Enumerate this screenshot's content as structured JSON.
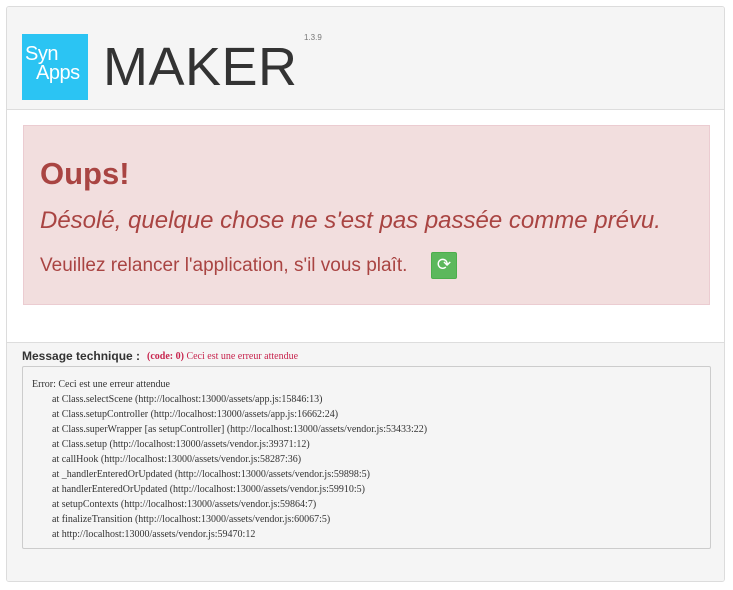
{
  "header": {
    "logo_line1": "Syn",
    "logo_line2": "Apps",
    "title": "MAKER",
    "version": "1.3.9"
  },
  "alert": {
    "title": "Oups!",
    "subtitle": "Désolé, quelque chose ne s'est pas passée comme prévu.",
    "message": "Veuillez relancer l'application, s'il vous plaît.",
    "refresh_icon": "refresh-icon",
    "refresh_symbol": "⟳",
    "bg_color": "#f2dede",
    "text_color": "#a94442",
    "button_color": "#5cb85c"
  },
  "technical": {
    "label": "Message technique :",
    "code_prefix": "(code: 0)",
    "code_message": "Ceci est une erreur attendue",
    "trace": [
      "Error: Ceci est une erreur attendue",
      "at Class.selectScene (http://localhost:13000/assets/app.js:15846:13)",
      "at Class.setupController (http://localhost:13000/assets/app.js:16662:24)",
      "at Class.superWrapper [as setupController] (http://localhost:13000/assets/vendor.js:53433:22)",
      "at Class.setup (http://localhost:13000/assets/vendor.js:39371:12)",
      "at callHook (http://localhost:13000/assets/vendor.js:58287:36)",
      "at _handlerEnteredOrUpdated (http://localhost:13000/assets/vendor.js:59898:5)",
      "at handlerEnteredOrUpdated (http://localhost:13000/assets/vendor.js:59910:5)",
      "at setupContexts (http://localhost:13000/assets/vendor.js:59864:7)",
      "at finalizeTransition (http://localhost:13000/assets/vendor.js:60067:5)",
      "at http://localhost:13000/assets/vendor.js:59470:12"
    ]
  }
}
